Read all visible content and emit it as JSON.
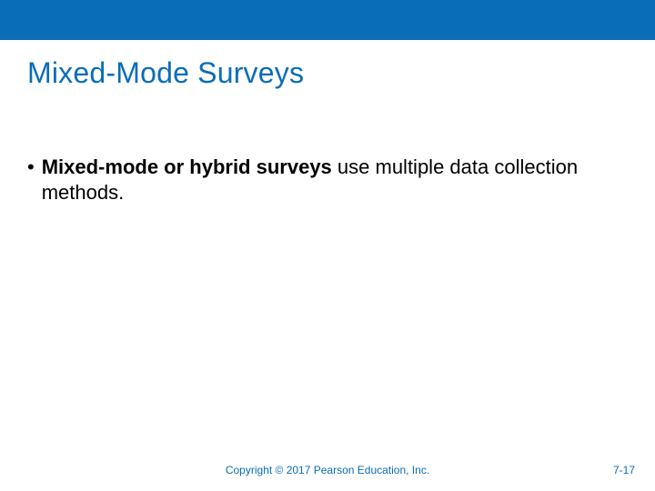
{
  "title": "Mixed-Mode Surveys",
  "bullet": {
    "dot": "•",
    "bold": "Mixed-mode or hybrid surveys",
    "rest": " use multiple data collection methods."
  },
  "footer": {
    "copyright": "Copyright © 2017 Pearson Education, Inc.",
    "page": "7-17"
  }
}
